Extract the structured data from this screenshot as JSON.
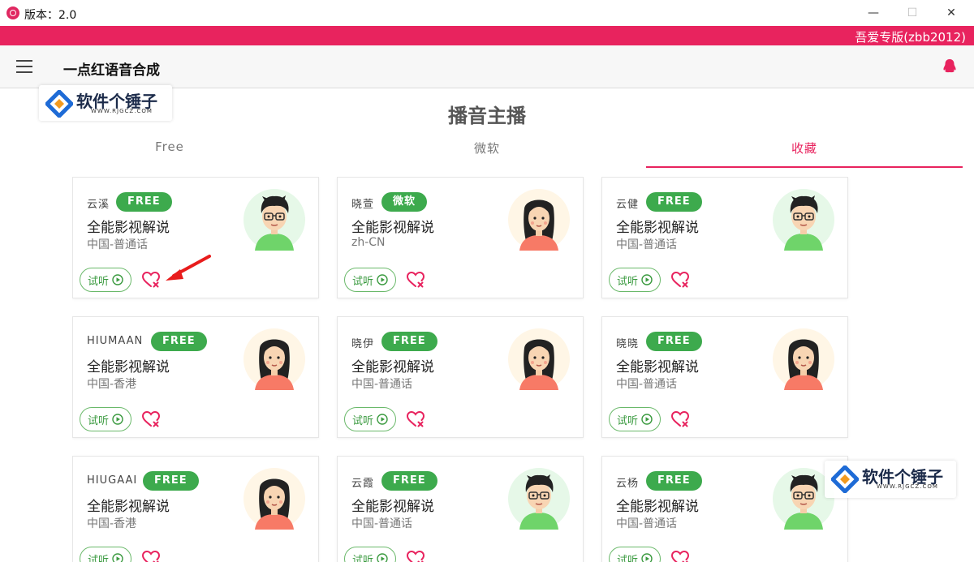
{
  "window": {
    "title": "版本：2.0",
    "controls": {
      "minimize": "—",
      "maximize": "☐",
      "close": "✕"
    }
  },
  "banner": {
    "text": "吾爱专版(zbb2012)"
  },
  "header": {
    "app_name": "一点红语音合成"
  },
  "watermark": {
    "text": "软件个锤子",
    "sub": "WWW.RJGCZ.COM"
  },
  "page": {
    "title": "播音主播"
  },
  "tabs": [
    {
      "label": "Free",
      "active": false
    },
    {
      "label": "微软",
      "active": false
    },
    {
      "label": "收藏",
      "active": true
    }
  ],
  "listen_label": "试听",
  "colors": {
    "accent": "#e8235e",
    "badge": "#3daa4d",
    "heart": "#e8235e"
  },
  "voices": [
    {
      "name": "云溪",
      "badge": "FREE",
      "style": "全能影视解说",
      "lang": "中国-普通话",
      "avatar": "male"
    },
    {
      "name": "晓萱",
      "badge": "微软",
      "style": "全能影视解说",
      "lang": "zh-CN",
      "avatar": "female"
    },
    {
      "name": "云健",
      "badge": "FREE",
      "style": "全能影视解说",
      "lang": "中国-普通话",
      "avatar": "male"
    },
    {
      "name": "HIUMAAN",
      "badge": "FREE",
      "style": "全能影视解说",
      "lang": "中国-香港",
      "avatar": "female"
    },
    {
      "name": "晓伊",
      "badge": "FREE",
      "style": "全能影视解说",
      "lang": "中国-普通话",
      "avatar": "female"
    },
    {
      "name": "晓晓",
      "badge": "FREE",
      "style": "全能影视解说",
      "lang": "中国-普通话",
      "avatar": "female"
    },
    {
      "name": "HIUGAAI",
      "badge": "FREE",
      "style": "全能影视解说",
      "lang": "中国-香港",
      "avatar": "female"
    },
    {
      "name": "云霞",
      "badge": "FREE",
      "style": "全能影视解说",
      "lang": "中国-普通话",
      "avatar": "male"
    },
    {
      "name": "云杨",
      "badge": "FREE",
      "style": "全能影视解说",
      "lang": "中国-普通话",
      "avatar": "male"
    }
  ]
}
